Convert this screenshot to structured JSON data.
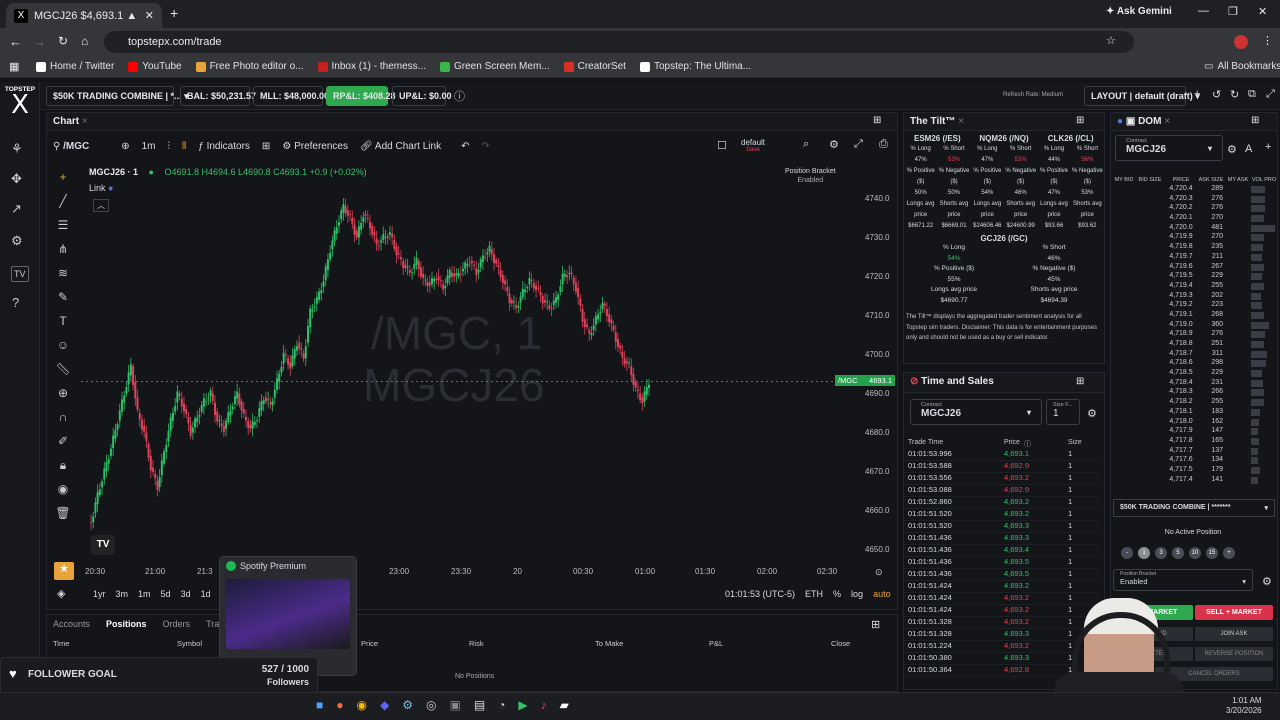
{
  "browser": {
    "tab_title": "MGCJ26 $4,693.1 ▲ +1.90%",
    "tab_favicon": "X",
    "ask_gemini": "Ask Gemini",
    "url": "topstepx.com/trade",
    "bookmarks": [
      {
        "label": "Home / Twitter",
        "color": "#ffffff"
      },
      {
        "label": "YouTube",
        "color": "#ff0000"
      },
      {
        "label": "Free Photo editor o...",
        "color": "#e8a33d"
      },
      {
        "label": "Inbox (1) - themess...",
        "color": "#c5221f"
      },
      {
        "label": "Green Screen Mem...",
        "color": "#39b54a"
      },
      {
        "label": "CreatorSet",
        "color": "#d93025"
      },
      {
        "label": "Topstep: The Ultima...",
        "color": "#ffffff"
      }
    ],
    "all_bookmarks": "All Bookmarks"
  },
  "app": {
    "logo_top": "TOPSTEP",
    "logo_mark": "X",
    "account": "$50K TRADING COMBINE | *...",
    "bal": "BAL: $50,231.57",
    "mll": "MLL: $48,000.00",
    "rpl": "RP&L: $408.28",
    "upl": "UP&L: $0.00",
    "refresh_rate": "Refresh Rate: Medium",
    "layout": "LAYOUT | default (draft)"
  },
  "chart": {
    "panel_title": "Chart",
    "symbol_search": "/MGC",
    "interval": "1m",
    "indicators": "Indicators",
    "preferences": "Preferences",
    "add_chart_link": "Add Chart Link",
    "template_name": "default",
    "template_sub": "Save",
    "position_bracket": "Position Bracket",
    "position_bracket_state": "Enabled",
    "symbol_title": "MGCJ26 · 1",
    "ohlc": "O4691.8  H4694.6  L4690.8  C4693.1  +0.9 (+0.02%)",
    "link_label": "Link",
    "watermark_line1": "/MGC, 1",
    "watermark_line2": "MGCJ26",
    "price_tag_symbol": "/MGC",
    "price_tag_value": "4693.1",
    "price_axis": [
      "4740.0",
      "4730.0",
      "4720.0",
      "4710.0",
      "4700.0",
      "4690.0",
      "4680.0",
      "4670.0",
      "4660.0",
      "4650.0"
    ],
    "time_axis": [
      "20:30",
      "21:00",
      "21:3",
      "23:00",
      "23:30",
      "20",
      "00:30",
      "01:00",
      "01:30",
      "02:00",
      "02:30"
    ],
    "ranges": [
      "1yr",
      "3m",
      "1m",
      "5d",
      "3d",
      "1d"
    ],
    "clock": "01:01:53 (UTC-5)",
    "eth": "ETH",
    "pct": "%",
    "log": "log",
    "auto": "auto"
  },
  "chart_data": {
    "type": "line",
    "x_label_start": "20:30",
    "x_label_end": "01:00",
    "ylim": [
      4645,
      4745
    ],
    "values": [
      4657,
      4664,
      4670,
      4676,
      4683,
      4690,
      4697,
      4685,
      4680,
      4671,
      4666,
      4675,
      4683,
      4690,
      4686,
      4680,
      4684,
      4688,
      4690,
      4683,
      4681,
      4686,
      4690,
      4684,
      4681,
      4684,
      4689,
      4687,
      4693,
      4700,
      4697,
      4703,
      4699,
      4711,
      4714,
      4719,
      4727,
      4733,
      4738,
      4735,
      4730,
      4736,
      4733,
      4728,
      4730,
      4731,
      4726,
      4723,
      4721,
      4724,
      4719,
      4718,
      4720,
      4717,
      4721,
      4720,
      4722,
      4724,
      4721,
      4725,
      4727,
      4723,
      4719,
      4714,
      4712,
      4716,
      4719,
      4717,
      4714,
      4712,
      4714,
      4720,
      4721,
      4717,
      4709,
      4705,
      4709,
      4713,
      4709,
      4704,
      4699,
      4697,
      4691,
      4688,
      4693.1
    ]
  },
  "tilt": {
    "title": "The Tilt™",
    "instruments": [
      {
        "name": "ESM26 (/ES)",
        "long_pct": "47%",
        "short_pct": "53%",
        "pos_pct": "50%",
        "neg_pct": "50%",
        "longs_avg": "$6671.22",
        "shorts_avg": "$6669.01"
      },
      {
        "name": "NQM26 (/NQ)",
        "long_pct": "47%",
        "short_pct": "53%",
        "pos_pct": "54%",
        "neg_pct": "46%",
        "longs_avg": "$24606.46",
        "shorts_avg": "$24600.99"
      },
      {
        "name": "CLK26 (/CL)",
        "long_pct": "44%",
        "short_pct": "56%",
        "pos_pct": "47%",
        "neg_pct": "53%",
        "longs_avg": "$93.66",
        "shorts_avg": "$93.62"
      }
    ],
    "labels": {
      "long": "% Long",
      "short": "% Short",
      "pos": "% Positive ($)",
      "neg": "% Negative ($)",
      "lap": "Longs avg price",
      "sap": "Shorts avg price"
    },
    "gc": {
      "name": "GCJ26 (/GC)",
      "long_pct": "54%",
      "short_pct": "46%",
      "pos_pct": "55%",
      "neg_pct": "45%",
      "longs_avg": "$4690.77",
      "shorts_avg": "$4694.39"
    },
    "disclaimer": "The Tilt™ displays the aggregated trader sentiment analysis for all Topstep sim traders. Disclaimer: This data is for entertainment purposes only and should not be used as a buy or sell indicator."
  },
  "ts": {
    "title": "Time and Sales",
    "contract_label": "Contract",
    "contract": "MGCJ26",
    "size_label": "Size F...",
    "size_value": "1",
    "headers": [
      "Trade Time",
      "Price",
      "Size"
    ],
    "rows": [
      [
        "01:01:53.996",
        "4,693.1",
        "1",
        "g"
      ],
      [
        "01:01:53.588",
        "4,692.9",
        "1",
        "r"
      ],
      [
        "01:01:53.556",
        "4,693.2",
        "1",
        "r"
      ],
      [
        "01:01:53.088",
        "4,692.9",
        "1",
        "r"
      ],
      [
        "01:01:52.860",
        "4,693.2",
        "1",
        "g"
      ],
      [
        "01:01:51.520",
        "4,693.2",
        "1",
        "g"
      ],
      [
        "01:01:51.520",
        "4,693.3",
        "1",
        "g"
      ],
      [
        "01:01:51.436",
        "4,693.3",
        "1",
        "g"
      ],
      [
        "01:01:51.436",
        "4,693.4",
        "1",
        "g"
      ],
      [
        "01:01:51.436",
        "4,693.5",
        "1",
        "g"
      ],
      [
        "01:01:51.436",
        "4,693.5",
        "1",
        "g"
      ],
      [
        "01:01:51.424",
        "4,693.2",
        "1",
        "g"
      ],
      [
        "01:01:51.424",
        "4,693.2",
        "1",
        "r"
      ],
      [
        "01:01:51.424",
        "4,693.2",
        "1",
        "r"
      ],
      [
        "01:01:51.328",
        "4,693.2",
        "1",
        "r"
      ],
      [
        "01:01:51.328",
        "4,693.3",
        "1",
        "g"
      ],
      [
        "01:01:51.224",
        "4,693.2",
        "1",
        "r"
      ],
      [
        "01:01:50.380",
        "4,693.3",
        "1",
        "g"
      ],
      [
        "01:01:50.364",
        "4,692.8",
        "1",
        "r"
      ]
    ]
  },
  "dom": {
    "title": "DOM",
    "contract_label": "Contract",
    "contract": "MGCJ26",
    "headers": [
      "MY BID",
      "BID SIZE",
      "PRICE",
      "ASK SIZE",
      "MY ASK",
      "VOL PRO"
    ],
    "rows": [
      [
        "4,720.4",
        "289"
      ],
      [
        "4,720.3",
        "276"
      ],
      [
        "4,720.2",
        "276"
      ],
      [
        "4,720.1",
        "270"
      ],
      [
        "4,720.0",
        "481"
      ],
      [
        "4,719.9",
        "270"
      ],
      [
        "4,719.8",
        "235"
      ],
      [
        "4,719.7",
        "211"
      ],
      [
        "4,719.6",
        "267"
      ],
      [
        "4,719.5",
        "229"
      ],
      [
        "4,719.4",
        "255"
      ],
      [
        "4,719.3",
        "202"
      ],
      [
        "4,719.2",
        "223"
      ],
      [
        "4,719.1",
        "268"
      ],
      [
        "4,719.0",
        "360"
      ],
      [
        "4,718.9",
        "276"
      ],
      [
        "4,718.8",
        "251"
      ],
      [
        "4,718.7",
        "311"
      ],
      [
        "4,718.6",
        "298"
      ],
      [
        "4,718.5",
        "229"
      ],
      [
        "4,718.4",
        "231"
      ],
      [
        "4,718.3",
        "266"
      ],
      [
        "4,718.2",
        "255"
      ],
      [
        "4,718.1",
        "183"
      ],
      [
        "4,718.0",
        "162"
      ],
      [
        "4,717.9",
        "147"
      ],
      [
        "4,717.8",
        "165"
      ],
      [
        "4,717.7",
        "137"
      ],
      [
        "4,717.6",
        "134"
      ],
      [
        "4,717.5",
        "179"
      ],
      [
        "4,717.4",
        "141"
      ]
    ],
    "account": "$50K TRADING COMBINE | *******",
    "no_position": "No Active Position",
    "qty_buttons": [
      "-",
      "1",
      "3",
      "5",
      "10",
      "15",
      "+"
    ],
    "bracket_label": "Position Bracket",
    "bracket_value": "Enabled",
    "buy_market": "BUY MARKET",
    "sell_market": "SELL + MARKET",
    "join_bid": "JOIN BID",
    "join_ask": "JOIN ASK",
    "flatten": "FLATTEN",
    "reverse": "REVERSE POSITION",
    "cancel_orders": "CANCEL ORDERS"
  },
  "bottom": {
    "tabs": [
      "Accounts",
      "Positions",
      "Orders",
      "Trades"
    ],
    "headers": [
      "Time",
      "Symbol",
      "Price",
      "Risk",
      "To Make",
      "P&L",
      "Close"
    ],
    "empty": "No Positions"
  },
  "overlays": {
    "spotify": "Spotify Premium",
    "goal_title": "FOLLOWER GOAL",
    "goal_count": "527 / 1000",
    "goal_unit": "Followers",
    "goal_progress": 0.527
  },
  "taskbar": {
    "time": "1:01 AM",
    "date": "3/20/2026"
  }
}
